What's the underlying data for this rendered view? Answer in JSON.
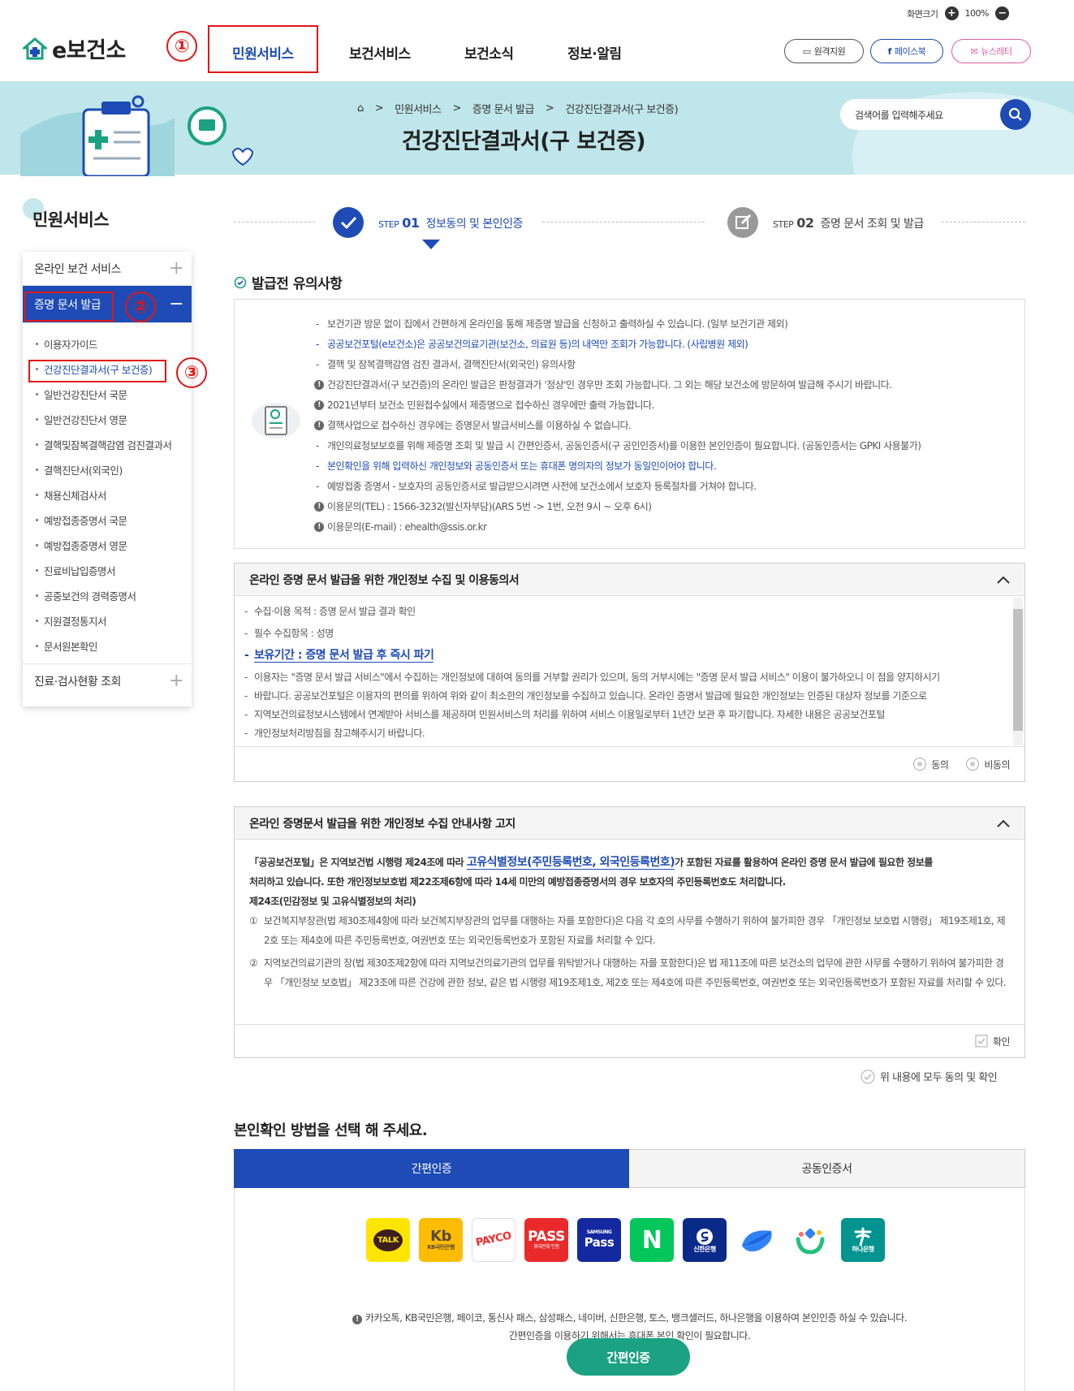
{
  "header": {
    "zoom_label": "화면크기",
    "zoom_plus": "+",
    "zoom_value": "100%",
    "zoom_minus": "−",
    "logo_text": "e보건소",
    "nav": [
      "민원서비스",
      "보건서비스",
      "보건소식",
      "정보·알림"
    ],
    "remote_label": "원격지원",
    "facebook_label": "페이스북",
    "newsletter_label": "뉴스레터"
  },
  "annotations": [
    "①",
    "②",
    "③"
  ],
  "banner": {
    "breadcrumb": [
      "민원서비스",
      "증명 문서 발급",
      "건강진단결과서(구 보건증)"
    ],
    "title": "건강진단결과서(구 보건증)",
    "search_placeholder": "검색어를 입력해주세요"
  },
  "sidebar": {
    "title": "민원서비스",
    "sections": [
      {
        "label": "온라인 보건 서비스",
        "toggle": "+"
      },
      {
        "label": "증명 문서 발급",
        "toggle": "−"
      },
      {
        "label": "진료·검사현황 조회",
        "toggle": "+"
      }
    ],
    "sub_items": [
      "이용자가이드",
      "건강진단결과서(구 보건증)",
      "일반건강진단서 국문",
      "일반건강진단서 영문",
      "결핵및잠복결핵감염 검진결과서",
      "결핵진단서(외국인)",
      "채용신체검사서",
      "예방접종증명서 국문",
      "예방접종증명서 영문",
      "진료비납입증명서",
      "공중보건의 경력증명서",
      "지원결정통지서",
      "문서원본확인"
    ]
  },
  "steps": {
    "step1_prefix": "STEP",
    "step1_num": "01",
    "step1_label": "정보동의 및 본인인증",
    "step2_prefix": "STEP",
    "step2_num": "02",
    "step2_label": "증명 문서 조회 및 발급"
  },
  "notice": {
    "title": "발급전 유의사항",
    "items": [
      {
        "type": "dash",
        "text": "보건기관 방문 없이 집에서 간편하게 온라인을 통해 제증명 발급을 신청하고 출력하실 수 있습니다. (일부 보건기관 제외)"
      },
      {
        "type": "blue",
        "text": "공공보건포털(e보건소)은 공공보건의료기관(보건소, 의료원 등)의 내역만 조회가 가능합니다. (사립병원 제외)"
      },
      {
        "type": "dash",
        "text": "결핵 및 잠복결핵감염 검진 결과서, 결핵진단서(외국인) 유의사항"
      },
      {
        "type": "ex",
        "text": "건강진단결과서(구 보건증)의 온라인 발급은 판정결과가 '정상'인 경우만 조회 가능합니다. 그 외는 해당 보건소에 방문하여 발급해 주시기 바랍니다."
      },
      {
        "type": "ex",
        "text": "2021년부터 보건소 민원접수실에서 제증명으로 접수하신 경우에만 출력 가능합니다."
      },
      {
        "type": "ex",
        "text": "결핵사업으로 접수하신 경우에는 증명문서 발급서비스를 이용하실 수 없습니다."
      },
      {
        "type": "dash",
        "text": "개인의료정보보호를 위해 제증명 조회 및 발급 시 간편인증서, 공동인증서(구 공인인증서)를 이용한 본인인증이 필요합니다. (공동인증서는 GPKI 사용불가)"
      },
      {
        "type": "blue",
        "text": "본인확인을 위해 입력하신 개인정보와 공동인증서 또는 휴대폰 명의자의 정보가 동일인이어야 합니다."
      },
      {
        "type": "dash",
        "text": "예방접종 증명서 - 보호자의 공동인증서로 발급받으시려면 사전에 보건소에서 보호자 등록절차를 거쳐야 합니다."
      },
      {
        "type": "ex",
        "text": "이용문의(TEL) : 1566-3232(발신자부담)(ARS 5번 -> 1번, 오전 9시 ~ 오후 6시)"
      },
      {
        "type": "ex",
        "text": "이용문의(E-mail) : ehealth@ssis.or.kr"
      }
    ]
  },
  "consent": {
    "title": "온라인 증명 문서 발급을 위한 개인정보 수집 및 이용동의서",
    "purpose": "수집·이용 목적 : 증명 문서 발급 결과 확인",
    "required": "필수 수집항목 : 성명",
    "retention": "보유기간 : 증명 문서 발급 후 즉시 파기",
    "body_lines": [
      "이용자는 \"증명 문서 발급 서비스\"에서 수집하는 개인정보에 대하여 동의를 거부할 권리가 있으며, 동의 거부시에는 \"증명 문서 발급 서비스\" 이용이 불가하오니 이 점을 양지하시기",
      "바랍니다. 공공보건포털은 이용자의 편의를 위하여 위와 같이 최소한의 개인정보를 수집하고 있습니다. 온라인 증명서 발급에 필요한 개인정보는 인증된 대상자 정보를 기준으로",
      "지역보건의료정보시스템에서 연계받아 서비스를 제공하며 민원서비스의 처리를 위하여 서비스 이용일로부터 1년간 보관 후 파기합니다. 자세한 내용은 공공보건포털",
      "개인정보처리방침을 참고해주시기 바랍니다."
    ],
    "agree": "동의",
    "disagree": "비동의"
  },
  "law": {
    "title": "온라인 증명문서 발급을 위한 개인정보 수집 안내사항 고지",
    "intro_a": "「공공보건포털」은 지역보건법 시행령 제24조에 따라 ",
    "intro_highlight": "고유식별정보(주민등록번호, 외국인등록번호)",
    "intro_b": "가 포함된 자료를 활용하여 온라인 증명 문서 발급에 필요한 정보를",
    "intro_c": "처리하고 있습니다. 또한 개인정보보호법 제22조제6항에 따라 14세 미만의 예방접종증명서의 경우 보호자의 주민등록번호도 처리합니다.",
    "article": "제24조(민감정보 및 고유식별정보의 처리)",
    "item1_num": "①",
    "item1": "보건복지부장관(법 제30조제4항에 따라 보건복지부장관의 업무를 대행하는 자를 포함한다)은 다음 각 호의 사무를 수행하기 위하여 불가피한 경우 「개인정보 보호법 시행령」 제19조제1호, 제2호 또는 제4호에 따른 주민등록번호, 여권번호 또는 외국인등록번호가 포함된 자료를 처리할 수 있다.",
    "item2_num": "②",
    "item2": "지역보건의료기관의 장(법 제30조제2항에 따라 지역보건의료기관의 업무를 위탁받거나 대행하는 자를 포함한다)은 법 제11조에 따른 보건소의 업무에 관한 사무를 수행하기 위하여 불가피한 경우 「개인정보 보호법」 제23조에 따른 건강에 관한 정보, 같은 법 시행령 제19조제1호, 제2호 또는 제4호에 따른 주민등록번호, 여권번호 또는 외국인등록번호가 포함된 자료를 처리할 수 있다.",
    "confirm": "확인"
  },
  "agree_all": "위 내용에 모두 동의 및 확인",
  "auth": {
    "title": "본인확인 방법을 선택 해 주세요.",
    "tab_simple": "간편인증",
    "tab_joint": "공동인증서",
    "icons": [
      {
        "name": "kakao",
        "text": "TALK",
        "bg": "#fee500",
        "fg": "#3c1e1e"
      },
      {
        "name": "kb",
        "text": "KB국민은행",
        "bg": "#ffbc00",
        "fg": "#5a4a3c"
      },
      {
        "name": "payco",
        "text": "PAYCO",
        "bg": "#ffffff",
        "fg": "#fa2828"
      },
      {
        "name": "pass",
        "text": "PASS",
        "bg": "#ea2a2a",
        "fg": "#ffffff"
      },
      {
        "name": "samsung",
        "text": "Pass",
        "bg": "#1428a0",
        "fg": "#ffffff"
      },
      {
        "name": "naver",
        "text": "N",
        "bg": "#03c75a",
        "fg": "#ffffff"
      },
      {
        "name": "shinhan",
        "text": "신한은행",
        "bg": "#0a2a8a",
        "fg": "#ffffff"
      },
      {
        "name": "toss",
        "text": "",
        "bg": "#ffffff",
        "fg": "#3182f6"
      },
      {
        "name": "banksalad",
        "text": "",
        "bg": "#ffffff",
        "fg": "#21c17a"
      },
      {
        "name": "hana",
        "text": "하나은행",
        "bg": "#009490",
        "fg": "#ffffff"
      }
    ],
    "kb_mark": "Kb",
    "pass_sub": "휴대전화 인증",
    "samsung_sub": "SAMSUNG",
    "info_line1": "카카오톡, KB국민은행, 페이코, 통신사 패스, 삼성패스, 네이버, 신한은행, 토스, 뱅크샐러드, 하나은행을 이용하여 본인인증 하실 수 있습니다.",
    "info_line2": "간편인증을 이용하기 위해서는 휴대폰 본인 확인이 필요합니다.",
    "button": "간편인증"
  }
}
